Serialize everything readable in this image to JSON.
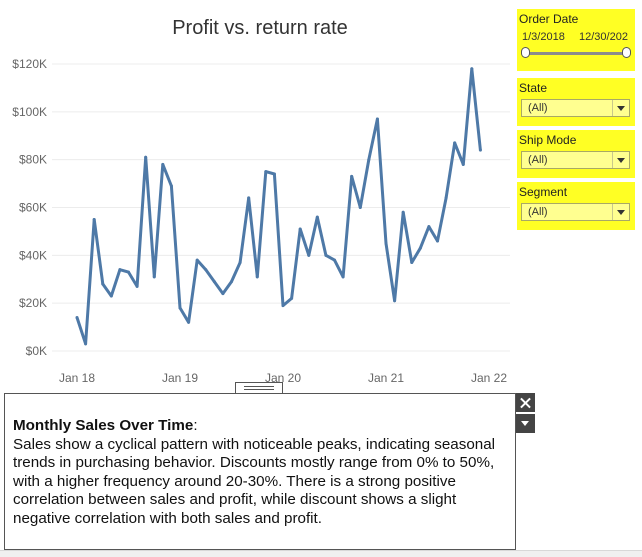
{
  "chart_data": {
    "type": "line",
    "title": "Profit vs. return rate",
    "x_tick_labels": [
      "Jan 18",
      "Jan 19",
      "Jan 20",
      "Jan 21",
      "Jan 22"
    ],
    "y_tick_labels": [
      "$0K",
      "$20K",
      "$40K",
      "$60K",
      "$80K",
      "$100K",
      "$120K"
    ],
    "ylim": [
      0,
      122000
    ],
    "grid": true,
    "series": [
      {
        "color": "#4e79a7",
        "x": [
          "2018-01",
          "2018-02",
          "2018-03",
          "2018-04",
          "2018-05",
          "2018-06",
          "2018-07",
          "2018-08",
          "2018-09",
          "2018-10",
          "2018-11",
          "2018-12",
          "2019-01",
          "2019-02",
          "2019-03",
          "2019-04",
          "2019-05",
          "2019-06",
          "2019-07",
          "2019-08",
          "2019-09",
          "2019-10",
          "2019-11",
          "2019-12",
          "2020-01",
          "2020-02",
          "2020-03",
          "2020-04",
          "2020-05",
          "2020-06",
          "2020-07",
          "2020-08",
          "2020-09",
          "2020-10",
          "2020-11",
          "2020-12",
          "2021-01",
          "2021-02",
          "2021-03",
          "2021-04",
          "2021-05",
          "2021-06",
          "2021-07",
          "2021-08",
          "2021-09",
          "2021-10",
          "2021-11",
          "2021-12"
        ],
        "values": [
          14000,
          3000,
          55000,
          28000,
          23000,
          34000,
          33000,
          27000,
          81000,
          31000,
          78000,
          69000,
          18000,
          12000,
          38000,
          34000,
          29000,
          24000,
          29000,
          37000,
          64000,
          31000,
          75000,
          74000,
          19000,
          22000,
          51000,
          40000,
          56000,
          40000,
          38000,
          31000,
          73000,
          60000,
          80000,
          97000,
          45000,
          21000,
          58000,
          37000,
          43000,
          52000,
          46000,
          64000,
          87000,
          78000,
          118000,
          84000
        ]
      }
    ]
  },
  "filters": {
    "order_date": {
      "title": "Order Date",
      "start": "1/3/2018",
      "end": "12/30/202",
      "start_fraction": 0.0,
      "end_fraction": 1.0
    },
    "state": {
      "title": "State",
      "value": "(All)"
    },
    "ship_mode": {
      "title": "Ship Mode",
      "value": "(All)"
    },
    "segment": {
      "title": "Segment",
      "value": "(All)"
    }
  },
  "tooltip": {
    "heading": "Monthly Sales Over Time",
    "colon": ":",
    "body": "Sales show a cyclical pattern with noticeable peaks, indicating seasonal trends in purchasing behavior. Discounts mostly range from 0% to 50%, with a higher frequency around 20-30%. There is a strong positive correlation between sales and profit, while discount shows a slight negative correlation with both sales and profit."
  },
  "colors": {
    "line": "#4e79a7",
    "filter_background": "#ffff24",
    "dropdown_background": "#ffff90"
  },
  "icons": {
    "close": "close-icon",
    "menu": "chevron-down-icon",
    "drag": "drag-handle-icon"
  }
}
